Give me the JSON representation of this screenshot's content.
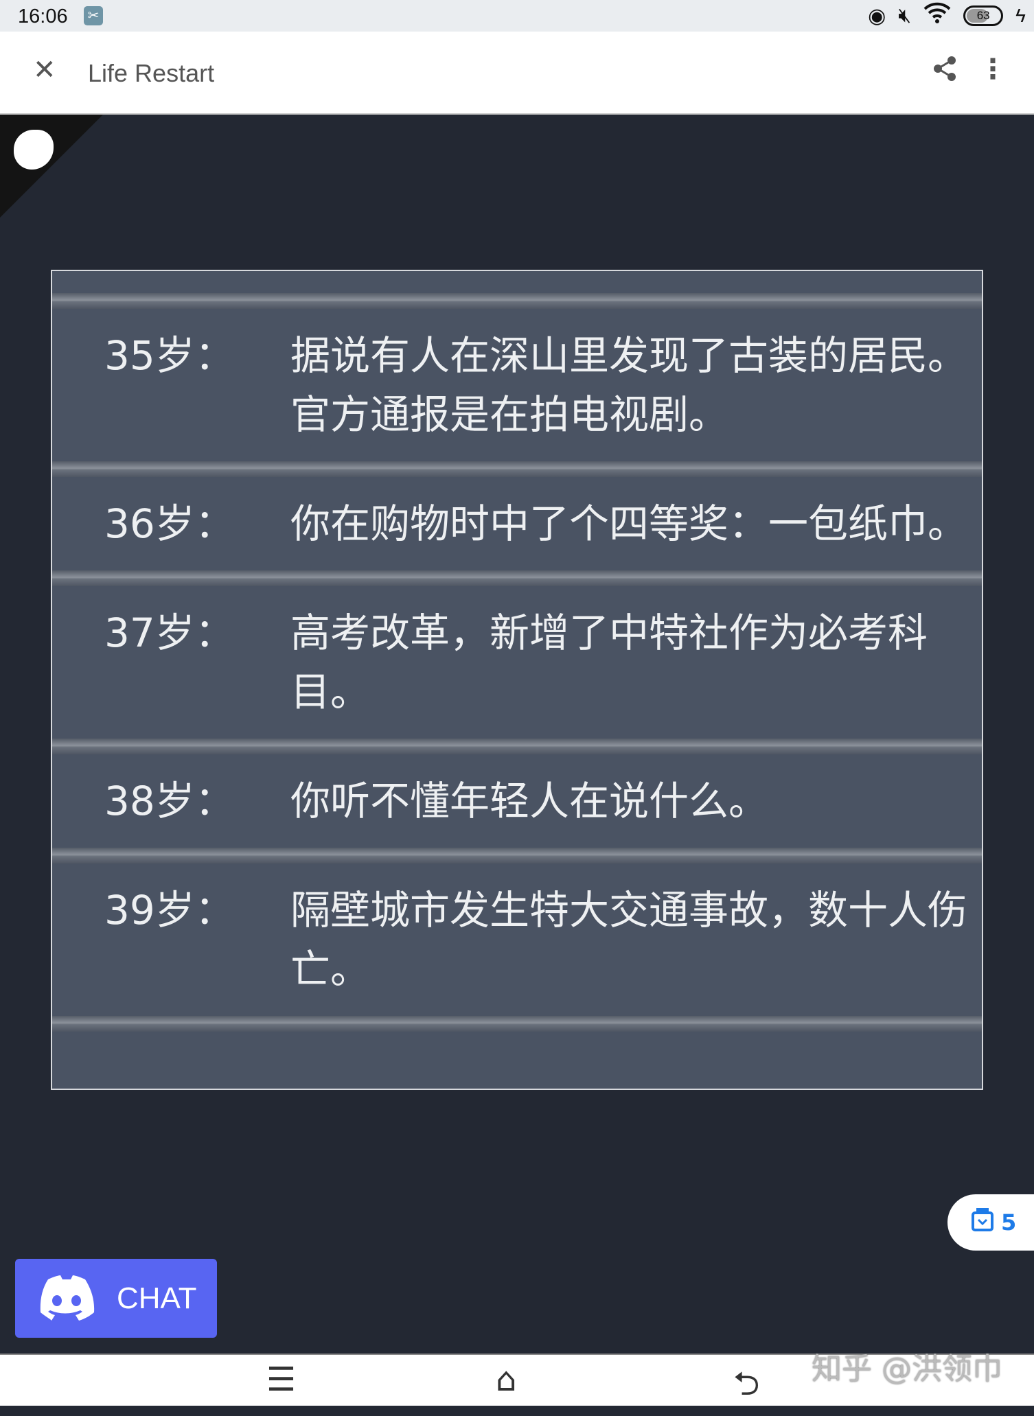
{
  "status_bar": {
    "time": "16:06",
    "battery": "63",
    "icons": [
      "scissors-app-icon",
      "eye-icon",
      "mute-icon",
      "wifi-icon",
      "battery-icon",
      "charging-icon"
    ]
  },
  "app_bar": {
    "title": "Life Restart",
    "close_icon": "close-icon",
    "share_icon": "share-icon",
    "more_icon": "more-vert-icon"
  },
  "events": [
    {
      "age": "35岁：",
      "text": "据说有人在深山里发现了古装的居民。官方通报是在拍电视剧。"
    },
    {
      "age": "36岁：",
      "text": "你在购物时中了个四等奖：一包纸巾。"
    },
    {
      "age": "37岁：",
      "text": "高考改革，新增了中特社作为必考科目。"
    },
    {
      "age": "38岁：",
      "text": "你听不懂年轻人在说什么。"
    },
    {
      "age": "39岁：",
      "text": "隔壁城市发生特大交通事故，数十人伤亡。"
    }
  ],
  "chat_button": {
    "label": "CHAT",
    "color": "#5865f2"
  },
  "badge": {
    "count": "5",
    "color": "#1e7be8"
  },
  "watermark": "知乎 @洪领巾",
  "colors": {
    "background": "#232833",
    "panel": "#4a5363"
  }
}
